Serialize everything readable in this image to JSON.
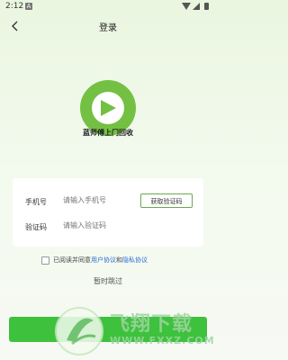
{
  "status_bar": {
    "time": "2:12",
    "notification_badge": "A"
  },
  "header": {
    "title": "登录",
    "back_icon": "chevron-left-icon"
  },
  "app": {
    "name": "蓝师傅上门回收",
    "logo_icon": "green-ring-play-logo",
    "brand_color": "#74c043"
  },
  "form": {
    "phone_label": "手机号",
    "phone_placeholder": "请输入手机号",
    "code_label": "验证码",
    "code_placeholder": "请输入验证码",
    "get_code_button": "获取验证码"
  },
  "agreement": {
    "prefix": "已阅读并同意",
    "user_agreement": "用户协议",
    "conjunction": "和",
    "privacy_policy": "隐私协议",
    "checked": false
  },
  "skip": {
    "label": "暂时跳过"
  },
  "login_button": {
    "color": "#3ec23e"
  },
  "watermark": {
    "title": "飞翔下载",
    "url": "WWW.FXXZ.COM"
  }
}
